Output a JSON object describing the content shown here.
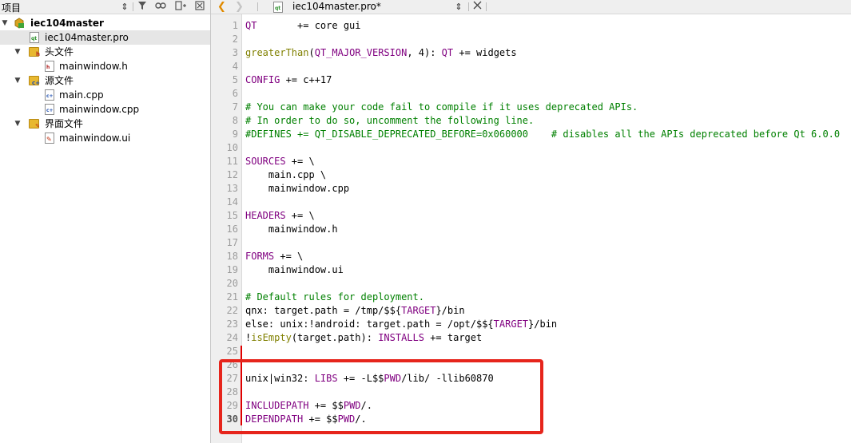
{
  "project_pane": {
    "title": "项目",
    "toolbar_icons": [
      "sort-updown-icon",
      "filter-icon",
      "link-icon",
      "split-add-icon",
      "close-icon"
    ],
    "tree": [
      {
        "label": "iec104master",
        "kind": "project",
        "expanded": true,
        "bold": true
      },
      {
        "label": "iec104master.pro",
        "kind": "pro-file",
        "selected": true
      },
      {
        "label": "头文件",
        "kind": "folder-headers",
        "expanded": true
      },
      {
        "label": "mainwindow.h",
        "kind": "header-file"
      },
      {
        "label": "源文件",
        "kind": "folder-sources",
        "expanded": true
      },
      {
        "label": "main.cpp",
        "kind": "cpp-file"
      },
      {
        "label": "mainwindow.cpp",
        "kind": "cpp-file"
      },
      {
        "label": "界面文件",
        "kind": "folder-forms",
        "expanded": true
      },
      {
        "label": "mainwindow.ui",
        "kind": "ui-file"
      }
    ]
  },
  "editor": {
    "tab_title": "iec104master.pro*",
    "accent_color": "#e6251c",
    "current_line": 30,
    "lines": [
      {
        "n": "1",
        "t": "QT       += core gui"
      },
      {
        "n": "2",
        "t": ""
      },
      {
        "n": "3",
        "t": "greaterThan(QT_MAJOR_VERSION, 4): QT += widgets"
      },
      {
        "n": "4",
        "t": ""
      },
      {
        "n": "5",
        "t": "CONFIG += c++17"
      },
      {
        "n": "6",
        "t": ""
      },
      {
        "n": "7",
        "t": "# You can make your code fail to compile if it uses deprecated APIs."
      },
      {
        "n": "8",
        "t": "# In order to do so, uncomment the following line."
      },
      {
        "n": "9",
        "t": "#DEFINES += QT_DISABLE_DEPRECATED_BEFORE=0x060000    # disables all the APIs deprecated before Qt 6.0.0"
      },
      {
        "n": "10",
        "t": ""
      },
      {
        "n": "11",
        "t": "SOURCES += \\"
      },
      {
        "n": "12",
        "t": "    main.cpp \\"
      },
      {
        "n": "13",
        "t": "    mainwindow.cpp"
      },
      {
        "n": "14",
        "t": ""
      },
      {
        "n": "15",
        "t": "HEADERS += \\"
      },
      {
        "n": "16",
        "t": "    mainwindow.h"
      },
      {
        "n": "17",
        "t": ""
      },
      {
        "n": "18",
        "t": "FORMS += \\"
      },
      {
        "n": "19",
        "t": "    mainwindow.ui"
      },
      {
        "n": "20",
        "t": ""
      },
      {
        "n": "21",
        "t": "# Default rules for deployment."
      },
      {
        "n": "22",
        "t": "qnx: target.path = /tmp/$${TARGET}/bin"
      },
      {
        "n": "23",
        "t": "else: unix:!android: target.path = /opt/$${TARGET}/bin"
      },
      {
        "n": "24",
        "t": "!isEmpty(target.path): INSTALLS += target"
      },
      {
        "n": "25",
        "t": ""
      },
      {
        "n": "26",
        "t": ""
      },
      {
        "n": "27",
        "t": "unix|win32: LIBS += -L$$PWD/lib/ -llib60870"
      },
      {
        "n": "28",
        "t": ""
      },
      {
        "n": "29",
        "t": "INCLUDEPATH += $$PWD/."
      },
      {
        "n": "30",
        "t": "DEPENDPATH += $$PWD/."
      }
    ]
  }
}
